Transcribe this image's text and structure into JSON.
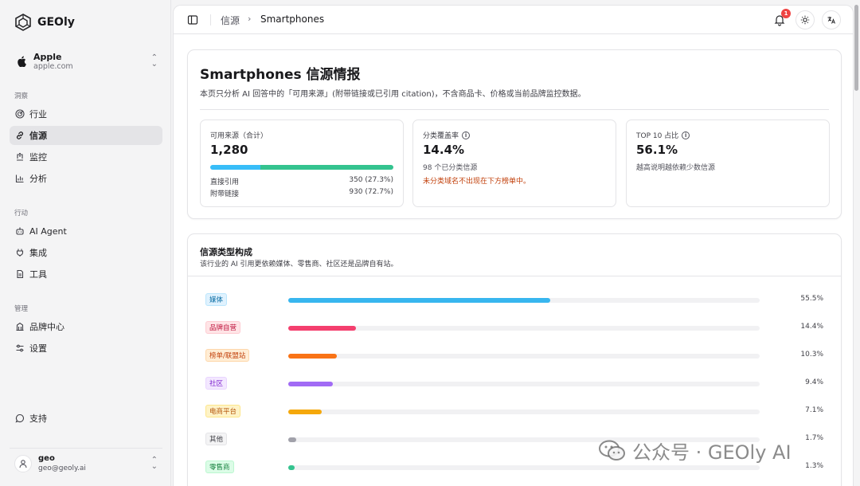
{
  "brand": {
    "name": "GEOly"
  },
  "org": {
    "name": "Apple",
    "domain": "apple.com"
  },
  "sidebar": {
    "sections": [
      {
        "title": "洞察",
        "items": [
          {
            "label": "行业",
            "icon": "radar-icon"
          },
          {
            "label": "信源",
            "icon": "link-icon",
            "active": true
          },
          {
            "label": "监控",
            "icon": "monitor-icon"
          },
          {
            "label": "分析",
            "icon": "bar-chart-icon"
          }
        ]
      },
      {
        "title": "行动",
        "items": [
          {
            "label": "AI Agent",
            "icon": "bot-icon"
          },
          {
            "label": "集成",
            "icon": "plug-icon"
          },
          {
            "label": "工具",
            "icon": "file-icon"
          }
        ]
      },
      {
        "title": "管理",
        "items": [
          {
            "label": "品牌中心",
            "icon": "building-icon"
          },
          {
            "label": "设置",
            "icon": "sliders-icon"
          }
        ]
      }
    ],
    "support": "支持"
  },
  "user": {
    "name": "geo",
    "email": "geo@geoly.ai"
  },
  "topbar": {
    "breadcrumb": [
      "信源",
      "Smartphones"
    ],
    "notification_count": "1"
  },
  "summary": {
    "title": "Smartphones 信源情报",
    "description": "本页只分析 AI 回答中的「可用来源」(附带链接或已引用 citation)，不含商品卡、价格或当前品牌监控数据。",
    "stats": [
      {
        "label": "可用来源（合计）",
        "value": "1,280",
        "split": [
          {
            "label": "直接引用",
            "value": "350 (27.3%)",
            "fraction": 0.273,
            "color": "#38bdf8"
          },
          {
            "label": "附带链接",
            "value": "930 (72.7%)",
            "fraction": 0.727,
            "color": "#34c38f"
          }
        ]
      },
      {
        "label": "分类覆盖率",
        "value": "14.4%",
        "sub": "98 个已分类信源",
        "warn": "未分类域名不出现在下方榜单中。"
      },
      {
        "label": "TOP 10 占比",
        "value": "56.1%",
        "sub": "越高说明越依赖少数信源"
      }
    ]
  },
  "composition": {
    "title": "信源类型构成",
    "description": "该行业的 AI 引用更依赖媒体、零售商、社区还是品牌自有站。",
    "rows": [
      {
        "label": "媒体",
        "pct": "55.5%",
        "value": 0.555,
        "color": "#38b6ef",
        "tag_bg": "#e0f2fe",
        "tag_fg": "#0369a1",
        "tag_border": "#bae6fd"
      },
      {
        "label": "品牌自营",
        "pct": "14.4%",
        "value": 0.144,
        "color": "#f43f6e",
        "tag_bg": "#ffe4e6",
        "tag_fg": "#be123c",
        "tag_border": "#fecdd3"
      },
      {
        "label": "榜单/联盟站",
        "pct": "10.3%",
        "value": 0.103,
        "color": "#f97316",
        "tag_bg": "#ffedd5",
        "tag_fg": "#c2410c",
        "tag_border": "#fed7aa"
      },
      {
        "label": "社区",
        "pct": "9.4%",
        "value": 0.094,
        "color": "#a16bf5",
        "tag_bg": "#f3e8ff",
        "tag_fg": "#7e22ce",
        "tag_border": "#e9d5ff"
      },
      {
        "label": "电商平台",
        "pct": "7.1%",
        "value": 0.071,
        "color": "#f5a80b",
        "tag_bg": "#fef3c7",
        "tag_fg": "#b45309",
        "tag_border": "#fde68a"
      },
      {
        "label": "其他",
        "pct": "1.7%",
        "value": 0.017,
        "color": "#a1a1aa",
        "tag_bg": "#f4f4f5",
        "tag_fg": "#3f3f46",
        "tag_border": "#e4e4e7"
      },
      {
        "label": "零售商",
        "pct": "1.3%",
        "value": 0.013,
        "color": "#34c38f",
        "tag_bg": "#dcfce7",
        "tag_fg": "#15803d",
        "tag_border": "#bbf7d0"
      }
    ]
  },
  "watermark": "公众号 · GEOly AI"
}
